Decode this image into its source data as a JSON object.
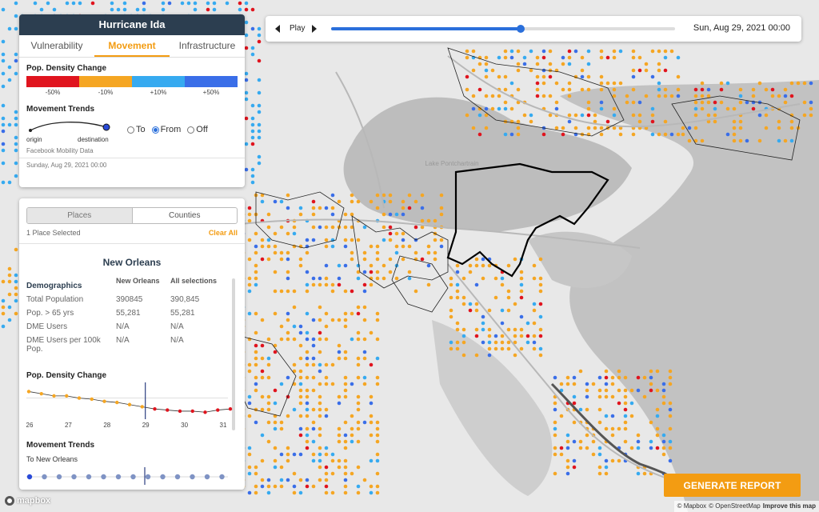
{
  "app": {
    "title": "Hurricane Ida"
  },
  "layer_panel": {
    "tabs": [
      {
        "label": "Vulnerability",
        "active": false
      },
      {
        "label": "Movement",
        "active": true
      },
      {
        "label": "Infrastructure",
        "active": false
      }
    ],
    "density_title": "Pop. Density Change",
    "legend": {
      "colors": [
        "#e0141e",
        "#f5a623",
        "#36aaf0",
        "#3a6ee8"
      ],
      "labels": [
        "-50%",
        "-10%",
        "+10%",
        "+50%"
      ]
    },
    "trends_title": "Movement Trends",
    "origin_label": "origin",
    "destination_label": "destination",
    "options": [
      {
        "label": "To",
        "selected": false
      },
      {
        "label": "From",
        "selected": true
      },
      {
        "label": "Off",
        "selected": false
      }
    ],
    "source": "Facebook Mobility Data",
    "date": "Sunday, Aug 29, 2021 00:00"
  },
  "places_panel": {
    "segments": [
      {
        "label": "Places",
        "active": true
      },
      {
        "label": "Counties",
        "active": false
      }
    ],
    "selected_count": "1 Place Selected",
    "clear_label": "Clear All",
    "place_name": "New Orleans",
    "demographics": {
      "headers": [
        "Demographics",
        "New Orleans",
        "All selections"
      ],
      "rows": [
        [
          "Total Population",
          "390845",
          "390,845"
        ],
        [
          "Pop. > 65 yrs",
          "55,281",
          "55,281"
        ],
        [
          "DME Users",
          "N/A",
          "N/A"
        ],
        [
          "DME Users per 100k Pop.",
          "N/A",
          "N/A"
        ]
      ]
    },
    "density_chart_title": "Pop. Density Change",
    "trends_title": "Movement Trends",
    "trends_sub": "To New Orleans"
  },
  "timeline": {
    "play_label": "Play",
    "date": "Sun, Aug 29, 2021 00:00",
    "progress": 0.55
  },
  "actions": {
    "generate_label": "GENERATE REPORT"
  },
  "map": {
    "logo": "mapbox",
    "attribution": [
      "© Mapbox",
      "© OpenStreetMap",
      "Improve this map"
    ],
    "label": "Lake Pontchartrain"
  },
  "chart_data": {
    "type": "line",
    "title": "Pop. Density Change",
    "x": [
      "26",
      "26",
      "26",
      "27",
      "27",
      "27",
      "27",
      "28",
      "28",
      "28",
      "28",
      "29",
      "29",
      "29",
      "30",
      "30",
      "30"
    ],
    "categories": [
      "26",
      "27",
      "28",
      "29",
      "30",
      "31"
    ],
    "xlabel": "",
    "ylabel": "",
    "marker_category": "28.5",
    "point_colors": [
      "#f5a623",
      "#f5a623",
      "#f5a623",
      "#f5a623",
      "#f5a623",
      "#f5a623",
      "#f5a623",
      "#f5a623",
      "#f5a623",
      "#f5a623",
      "#e0141e",
      "#e0141e",
      "#e0141e",
      "#e0141e",
      "#e0141e",
      "#e0141e",
      "#e0141e"
    ],
    "values": [
      0.6,
      0.4,
      0.2,
      0.2,
      0.0,
      -0.1,
      -0.3,
      -0.4,
      -0.6,
      -0.8,
      -1.0,
      -1.1,
      -1.2,
      -1.2,
      -1.3,
      -1.1,
      -1.0
    ]
  }
}
